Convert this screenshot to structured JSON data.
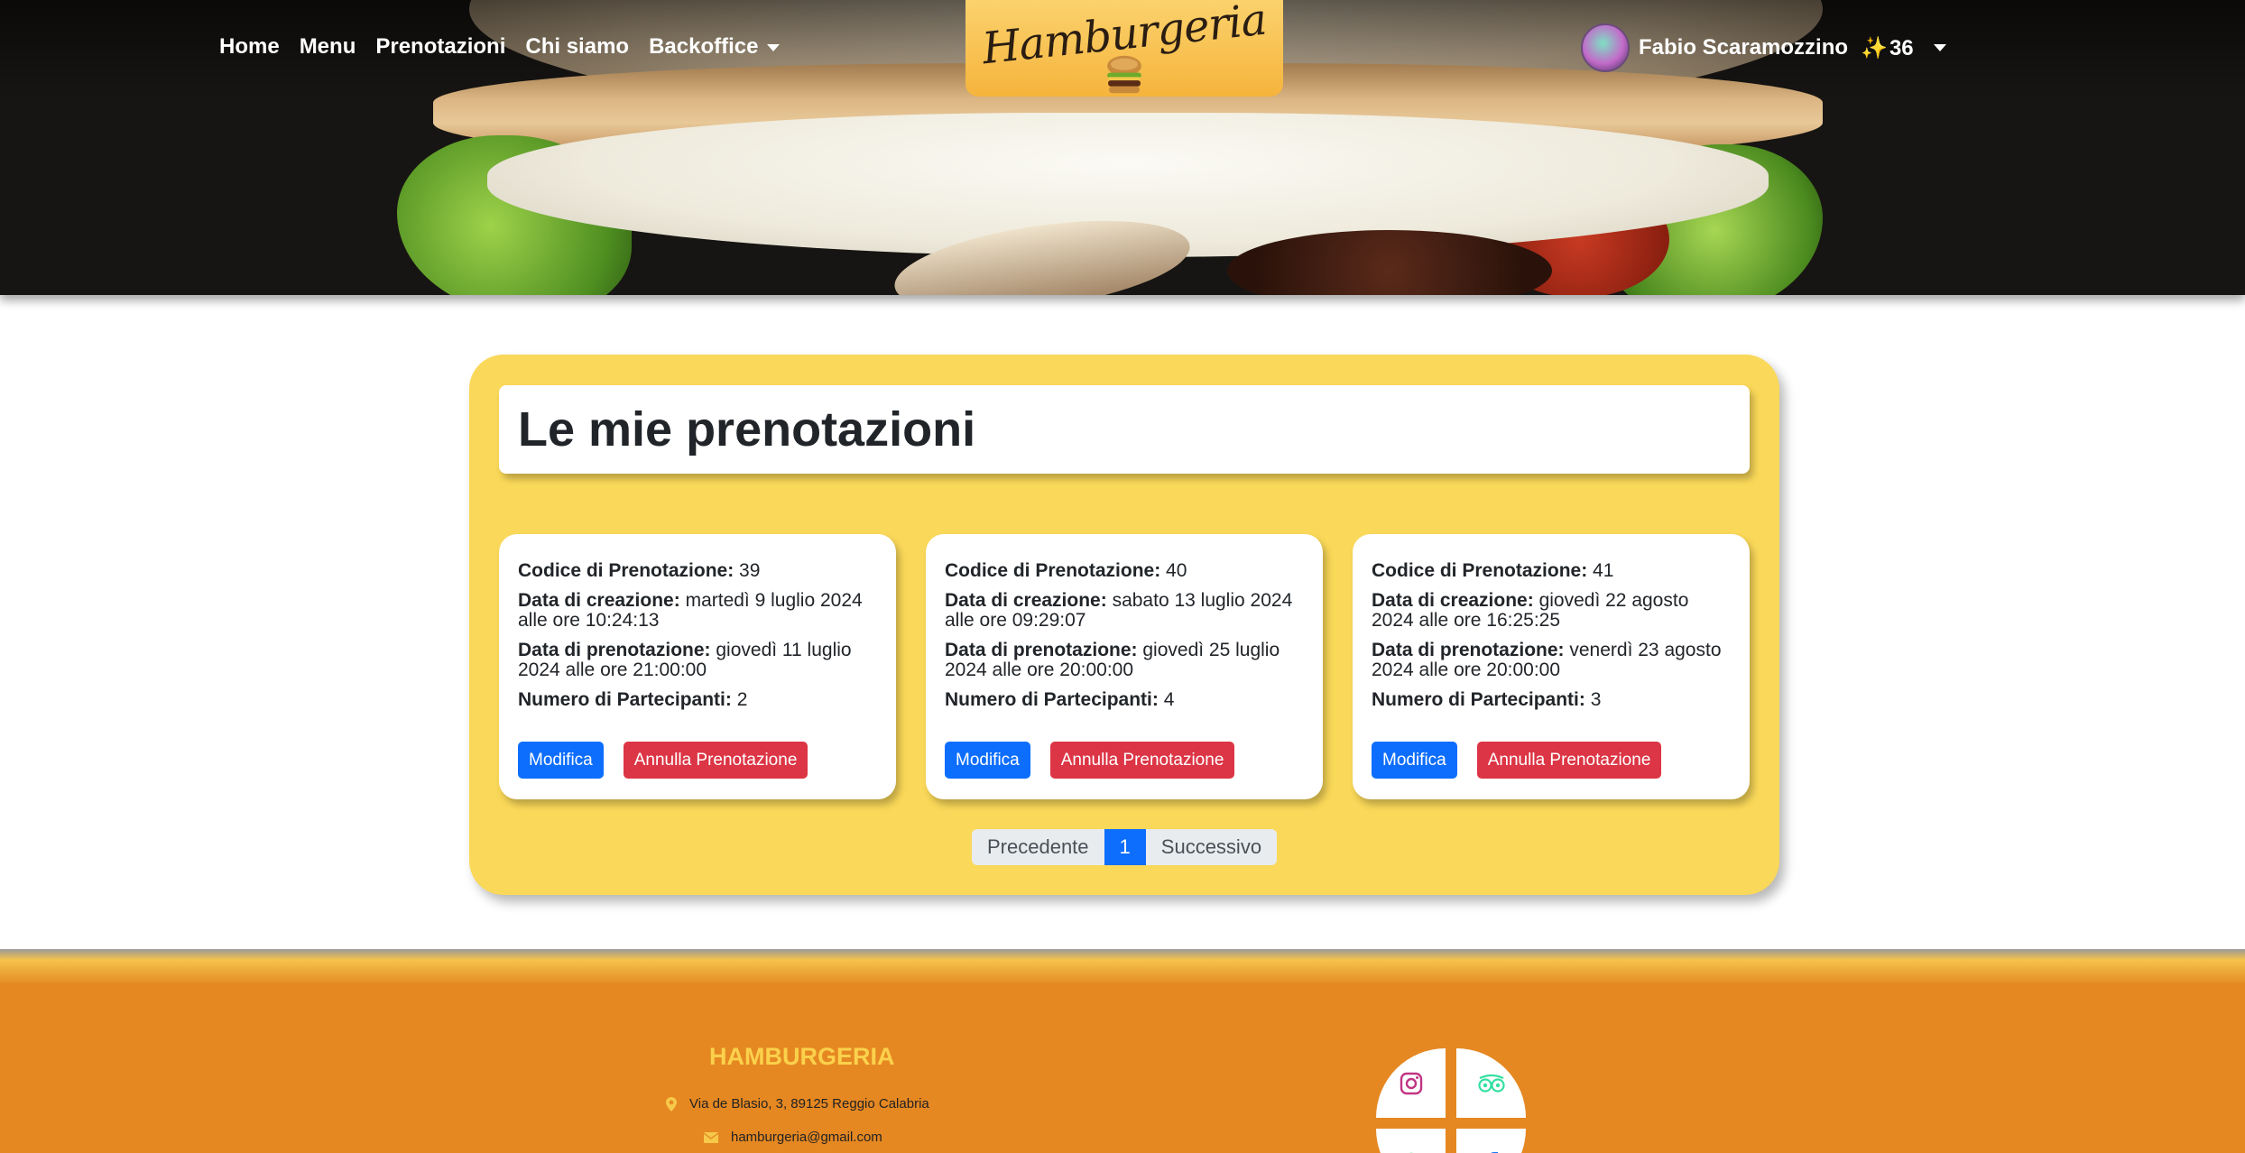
{
  "nav": {
    "home": "Home",
    "menu": "Menu",
    "prenotazioni": "Prenotazioni",
    "chi_siamo": "Chi siamo",
    "backoffice": "Backoffice"
  },
  "logo": {
    "text": "Hamburgeria"
  },
  "user": {
    "name": "Fabio Scaramozzino",
    "points_icon": "✨",
    "points": "36"
  },
  "page": {
    "title": "Le mie prenotazioni"
  },
  "labels": {
    "codice": "Codice di Prenotazione:",
    "creazione": "Data di creazione:",
    "prenotazione": "Data di prenotazione:",
    "partecipanti": "Numero di Partecipanti:",
    "modifica": "Modifica",
    "annulla": "Annulla Prenotazione"
  },
  "reservations": [
    {
      "codice": "39",
      "creazione": "martedì 9 luglio 2024 alle ore 10:24:13",
      "prenotazione": "giovedì 11 luglio 2024 alle ore 21:00:00",
      "partecipanti": "2"
    },
    {
      "codice": "40",
      "creazione": "sabato 13 luglio 2024 alle ore 09:29:07",
      "prenotazione": "giovedì 25 luglio 2024 alle ore 20:00:00",
      "partecipanti": "4"
    },
    {
      "codice": "41",
      "creazione": "giovedì 22 agosto 2024 alle ore 16:25:25",
      "prenotazione": "venerdì 23 agosto 2024 alle ore 20:00:00",
      "partecipanti": "3"
    }
  ],
  "pagination": {
    "prev": "Precedente",
    "current": "1",
    "next": "Successivo"
  },
  "footer": {
    "brand": "HAMBURGERIA",
    "address": "Via de Blasio, 3, 89125 Reggio Calabria",
    "email": "hamburgeria@gmail.com"
  },
  "icons": {
    "social": [
      "instagram-icon",
      "tripadvisor-icon",
      "whatsapp-icon",
      "facebook-icon"
    ],
    "address": "map-pin-icon",
    "email": "envelope-icon"
  },
  "colors": {
    "panel": "#fad859",
    "footer": "#e58822",
    "primary": "#0d6efd",
    "danger": "#dc3545",
    "brand_yellow": "#fbd14c"
  }
}
